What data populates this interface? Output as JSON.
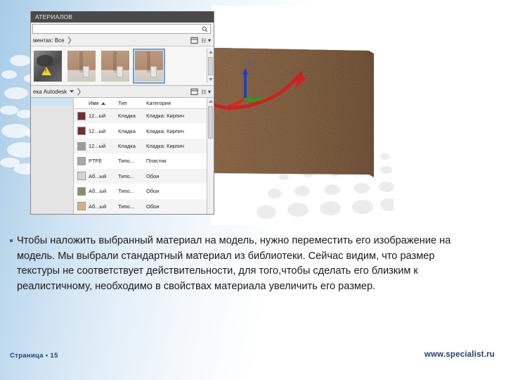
{
  "slide": {
    "body_text": "Чтобы наложить выбранный материал на модель, нужно переместить его изображение на модель. Мы выбрали стандартный материал из библиотеки. Сейчас видим, что размер текстуры не соответствует действительности, для того,чтобы сделать его близким к реалистичному, необходимо в свойствах материала увеличить его размер.",
    "bullet": "▪"
  },
  "footer": {
    "page_label": "Страница ▪ 15",
    "page_number": "15",
    "url": "www.specialist.ru",
    "accent_color": "#1f3f73"
  },
  "screenshot": {
    "panel": {
      "title": "АТЕРИАЛОВ",
      "search_placeholder": "",
      "search_value": "",
      "search_icon": "search-icon",
      "breadcrumb": "ментах: Все",
      "breadcrumb_chevron": "❯",
      "library_label": "ека Autodesk",
      "library_caret": "▾",
      "view_grid_icon": "grid-view-icon",
      "view_list_icon": "list-view-icon",
      "view_menu_caret": "▾"
    },
    "thumbnails": [
      {
        "name": "thumb-warning",
        "selected": false,
        "warning": true,
        "color": "#5f5f5f"
      },
      {
        "name": "thumb-brick-1",
        "selected": false,
        "warning": false,
        "color": "#b08a6e"
      },
      {
        "name": "thumb-brick-2",
        "selected": false,
        "warning": false,
        "color": "#b08a6e"
      },
      {
        "name": "thumb-brick-3",
        "selected": true,
        "warning": false,
        "color": "#b08a6e"
      }
    ],
    "table": {
      "columns": [
        "",
        "Имя",
        "Тип",
        "Категория"
      ],
      "sort_column": "Имя",
      "sort_direction": "ascending",
      "rows": [
        {
          "swatch": "#7a2d2d",
          "name": "12...ый",
          "type": "Кладка",
          "category": "Кладка: Кирпич"
        },
        {
          "swatch": "#7a2d2d",
          "name": "12...ый",
          "type": "Кладка",
          "category": "Кладка: Кирпич"
        },
        {
          "swatch": "#9c9c9c",
          "name": "12...ый",
          "type": "Кладка",
          "category": "Кладка: Кирпич"
        },
        {
          "swatch": "#a8a8a8",
          "name": "PTFE",
          "type": "Типо...",
          "category": "Пластик"
        },
        {
          "swatch": "#d5d5d0",
          "name": "Аб...ый",
          "type": "Типо...",
          "category": "Обои"
        },
        {
          "swatch": "#8a8f6a",
          "name": "Аб...ый",
          "type": "Типо...",
          "category": "Обои"
        },
        {
          "swatch": "#d8b078",
          "name": "Аб...ый",
          "type": "Типо...",
          "category": "Обои"
        }
      ]
    },
    "viewport": {
      "wall_label": "textured-wall",
      "axis_z_label": "Z",
      "axis_x_color": "#d92b20",
      "axis_y_color": "#17a81a",
      "axis_z_color": "#1a3fd6",
      "annotation_arrow_color": "#cc2222"
    }
  }
}
